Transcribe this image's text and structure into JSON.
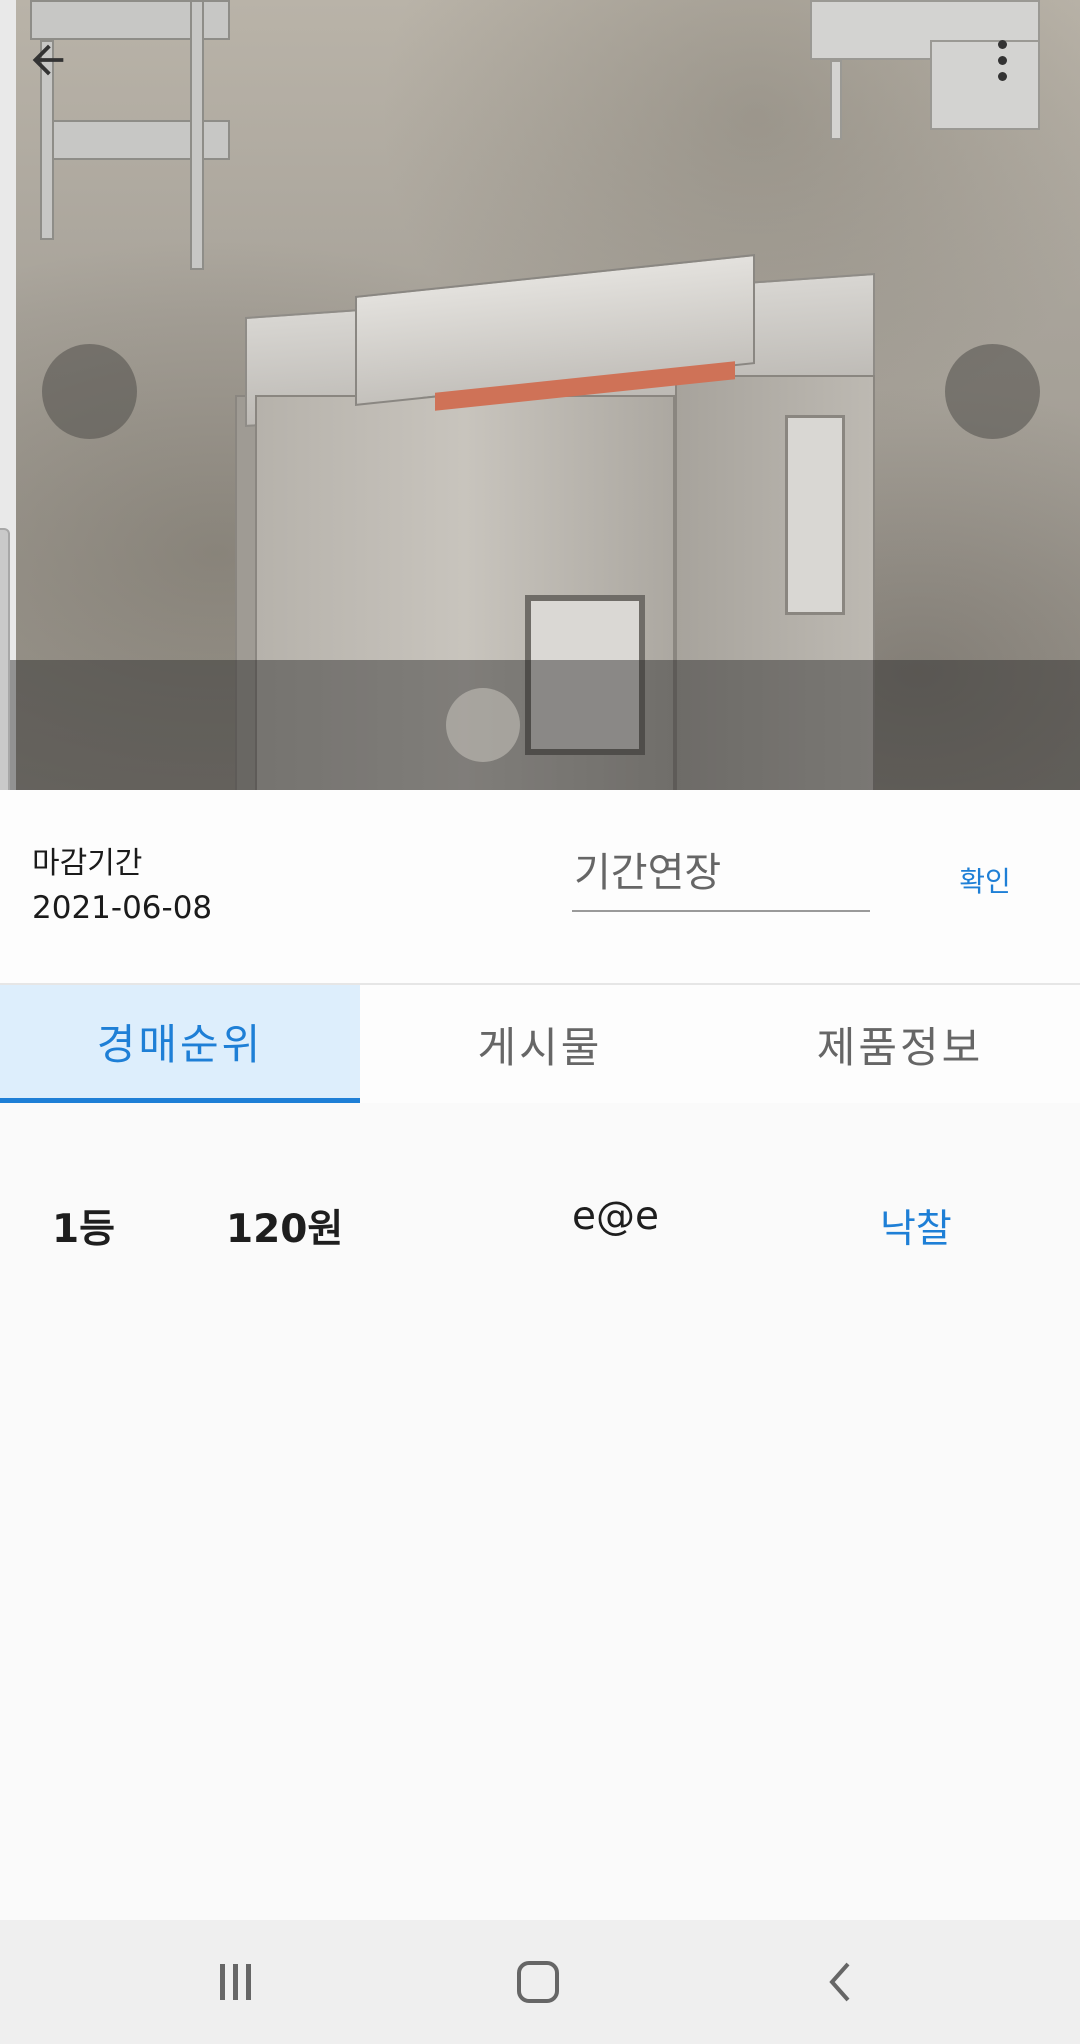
{
  "hero": {
    "icons": {
      "back": "arrow-left-icon",
      "more": "more-vert-icon",
      "prev": "prev-image-button",
      "next": "next-image-button"
    }
  },
  "deadline": {
    "label": "마감기간",
    "date": "2021-06-08",
    "extend_placeholder": "기간연장",
    "confirm_label": "확인"
  },
  "tabs": [
    {
      "label": "경매순위",
      "active": true
    },
    {
      "label": "게시물",
      "active": false
    },
    {
      "label": "제품정보",
      "active": false
    }
  ],
  "ranking": [
    {
      "rank": "1등",
      "amount": "120원",
      "user": "e@e",
      "action": "낙찰"
    }
  ],
  "colors": {
    "accent": "#1e7fd6",
    "active_tab_bg": "#ddeefc",
    "top_bar": "#6a3ad8"
  },
  "system_nav": {
    "recent": "recent-apps-icon",
    "home": "home-icon",
    "back": "back-icon"
  }
}
